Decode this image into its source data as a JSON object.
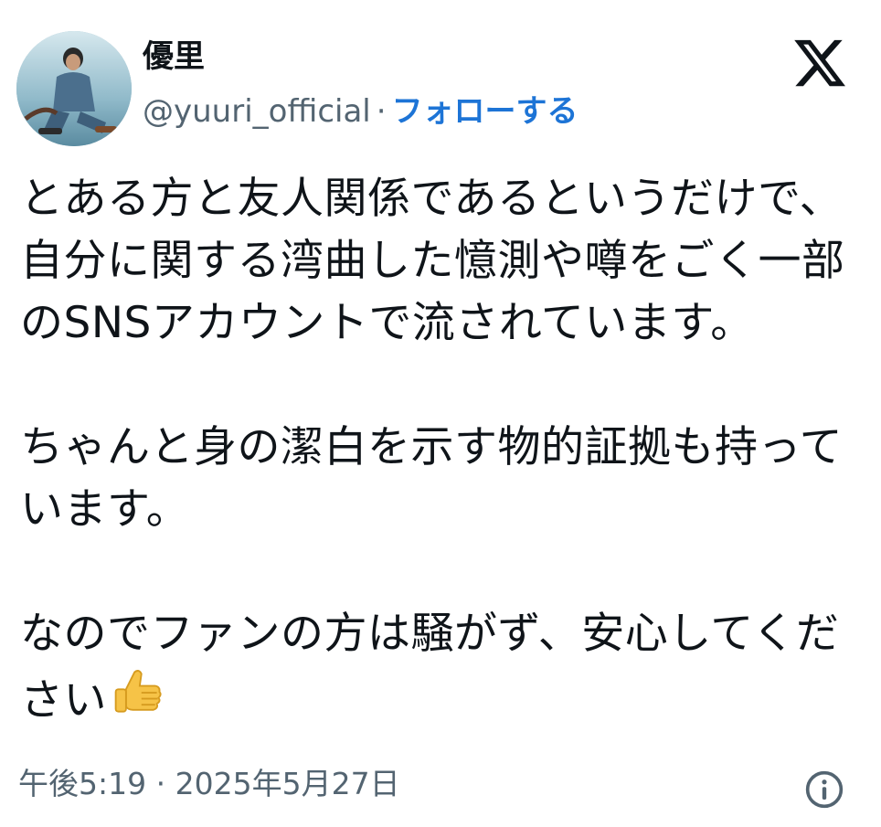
{
  "author": {
    "display_name": "優里",
    "handle": "@yuuri_official",
    "separator": "·",
    "follow_label": "フォローする"
  },
  "tweet": {
    "paragraph1": "とある方と友人関係であるというだけで、自分に関する湾曲した憶測や噂をごく一部のSNSアカウントで流されています。",
    "paragraph2": "ちゃんと身の潔白を示す物的証拠も持っています。",
    "paragraph3": "なのでファンの方は騒がず、安心してください",
    "emoji": "thumbs-up-emoji"
  },
  "meta": {
    "time": "午後5:19",
    "separator": "·",
    "date": "2025年5月27日"
  },
  "icons": {
    "x_logo": "x-logo-icon",
    "info": "info-icon"
  },
  "colors": {
    "follow": "#1d74d6",
    "secondary_text": "#536471",
    "primary_text": "#0f1419"
  }
}
